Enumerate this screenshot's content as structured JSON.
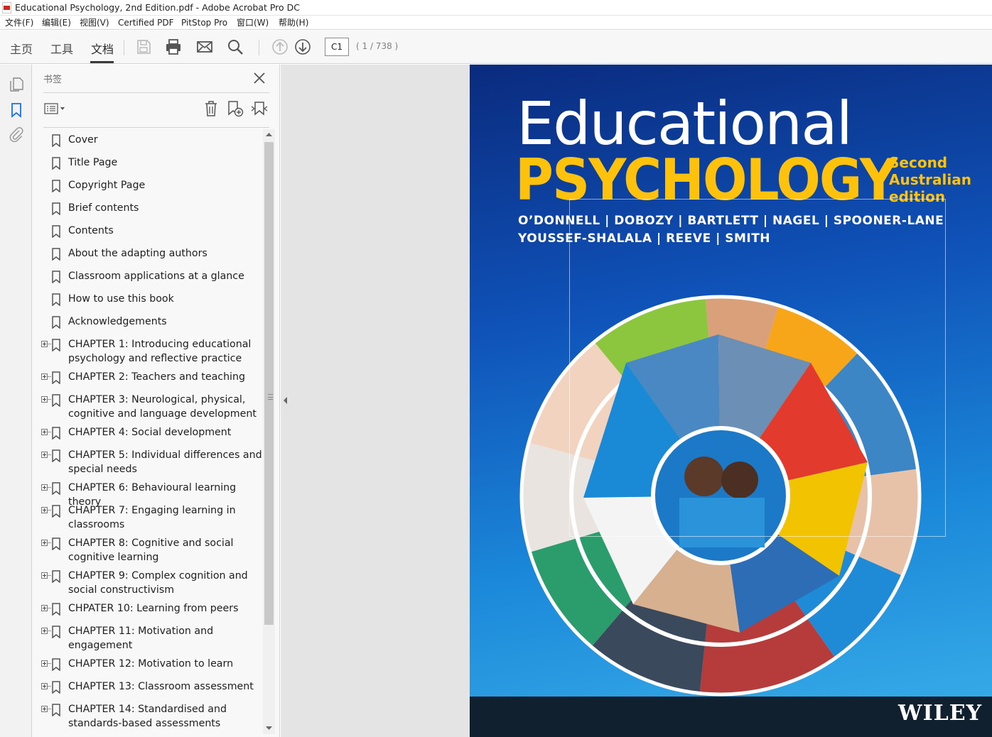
{
  "window": {
    "title": "Educational Psychology, 2nd Edition.pdf - Adobe Acrobat Pro DC"
  },
  "menu": [
    "文件(F)",
    "编辑(E)",
    "视图(V)",
    "Certified PDF",
    "PitStop Pro",
    "窗口(W)",
    "帮助(H)"
  ],
  "toolbar": {
    "tabs": [
      "主页",
      "工具",
      "文档"
    ],
    "active_tab": "文档",
    "icons": [
      "save-icon",
      "print-icon",
      "email-icon",
      "search-icon",
      "page-up-icon",
      "page-down-icon"
    ],
    "page_input": "C1",
    "page_count": "( 1 / 738 )"
  },
  "rail": {
    "icons": [
      "page-thumbnails-icon",
      "bookmarks-icon",
      "attachments-icon"
    ]
  },
  "bookmarks_panel": {
    "title": "书签",
    "tools": [
      "options-menu-icon",
      "delete-bookmark-icon",
      "new-bookmark-icon",
      "bookmark-from-structure-icon"
    ],
    "items": [
      {
        "label": "Cover",
        "expandable": false
      },
      {
        "label": "Title Page",
        "expandable": false
      },
      {
        "label": "Copyright Page",
        "expandable": false
      },
      {
        "label": "Brief contents",
        "expandable": false
      },
      {
        "label": "Contents",
        "expandable": false
      },
      {
        "label": "About the adapting authors",
        "expandable": false
      },
      {
        "label": "Classroom applications at a glance",
        "expandable": false
      },
      {
        "label": "How to use this book",
        "expandable": false
      },
      {
        "label": "Acknowledgements",
        "expandable": false
      },
      {
        "label": "CHAPTER 1: Introducing educational psychology and reflective practice",
        "expandable": true
      },
      {
        "label": "CHAPTER 2: Teachers and teaching",
        "expandable": true
      },
      {
        "label": "CHAPTER 3: Neurological, physical, cognitive and language development",
        "expandable": true
      },
      {
        "label": "CHAPTER 4: Social development",
        "expandable": true
      },
      {
        "label": "CHAPTER 5: Individual differences and special needs",
        "expandable": true
      },
      {
        "label": "CHAPTER 6: Behavioural learning theory",
        "expandable": true
      },
      {
        "label": "CHAPTER 7: Engaging learning in classrooms",
        "expandable": true
      },
      {
        "label": "CHAPTER 8: Cognitive and social cognitive learning",
        "expandable": true
      },
      {
        "label": "CHAPTER 9: Complex cognition and social constructivism",
        "expandable": true
      },
      {
        "label": "CHPATER 10: Learning from peers",
        "expandable": true
      },
      {
        "label": "CHAPTER 11: Motivation and engagement",
        "expandable": true
      },
      {
        "label": "CHAPTER 12: Motivation to learn",
        "expandable": true
      },
      {
        "label": "CHAPTER 13: Classroom assessment",
        "expandable": true
      },
      {
        "label": "CHAPTER 14: Standardised and standards-based  assessments",
        "expandable": true
      }
    ]
  },
  "cover": {
    "title": "Educational",
    "subtitle": "PSYCHOLOGY",
    "edition_lines": [
      "Second",
      "Australian",
      "edition"
    ],
    "authors_line1": "O’DONNELL  |  DOBOZY  |  BARTLETT  |  NAGEL  |  SPOONER-LANE",
    "authors_line2": "YOUSSEF-SHALALA  |  REEVE  |  SMITH",
    "publisher": "WILEY",
    "colors": {
      "title": "#ffffff",
      "subtitle": "#fec20d",
      "background_top": "#0a2b7e",
      "background_bottom": "#3ab0ea",
      "footer": "#10202e"
    }
  }
}
